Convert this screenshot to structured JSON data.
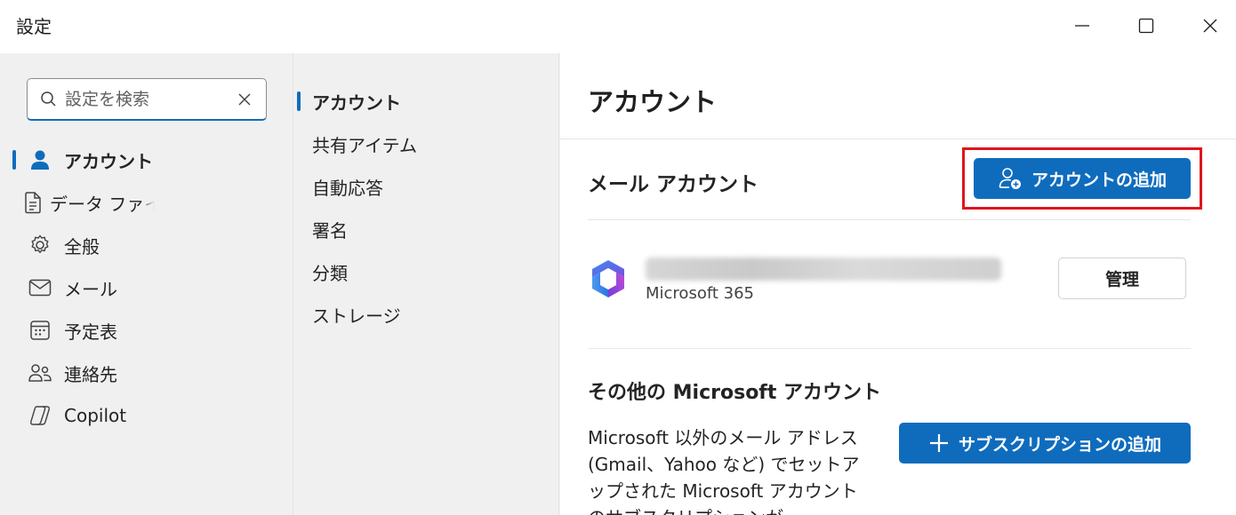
{
  "window": {
    "title": "設定"
  },
  "search": {
    "placeholder": "設定を検索"
  },
  "left_nav": {
    "items": [
      {
        "label": "アカウント",
        "icon": "person-icon",
        "active": true
      },
      {
        "label": "データ ファイル",
        "icon": "document-icon"
      },
      {
        "label": "全般",
        "icon": "gear-icon"
      },
      {
        "label": "メール",
        "icon": "mail-icon"
      },
      {
        "label": "予定表",
        "icon": "calendar-icon"
      },
      {
        "label": "連絡先",
        "icon": "people-icon"
      },
      {
        "label": "Copilot",
        "icon": "copilot-icon"
      }
    ]
  },
  "sub_nav": {
    "items": [
      {
        "label": "アカウント",
        "active": true
      },
      {
        "label": "共有アイテム"
      },
      {
        "label": "自動応答"
      },
      {
        "label": "署名"
      },
      {
        "label": "分類"
      },
      {
        "label": "ストレージ"
      }
    ]
  },
  "main": {
    "heading": "アカウント",
    "mail_accounts": {
      "title": "メール アカウント",
      "add_button": "アカウントの追加",
      "account": {
        "type": "Microsoft 365",
        "manage_button": "管理"
      }
    },
    "other_accounts": {
      "title": "その他の Microsoft アカウント",
      "description": "Microsoft 以外のメール アドレス (Gmail、Yahoo など) でセットアップされた Microsoft アカウントのサブスクリプションが",
      "add_subscription_button": "サブスクリプションの追加"
    }
  },
  "colors": {
    "accent": "#0f6cbd",
    "highlight_border": "#e0141e"
  }
}
